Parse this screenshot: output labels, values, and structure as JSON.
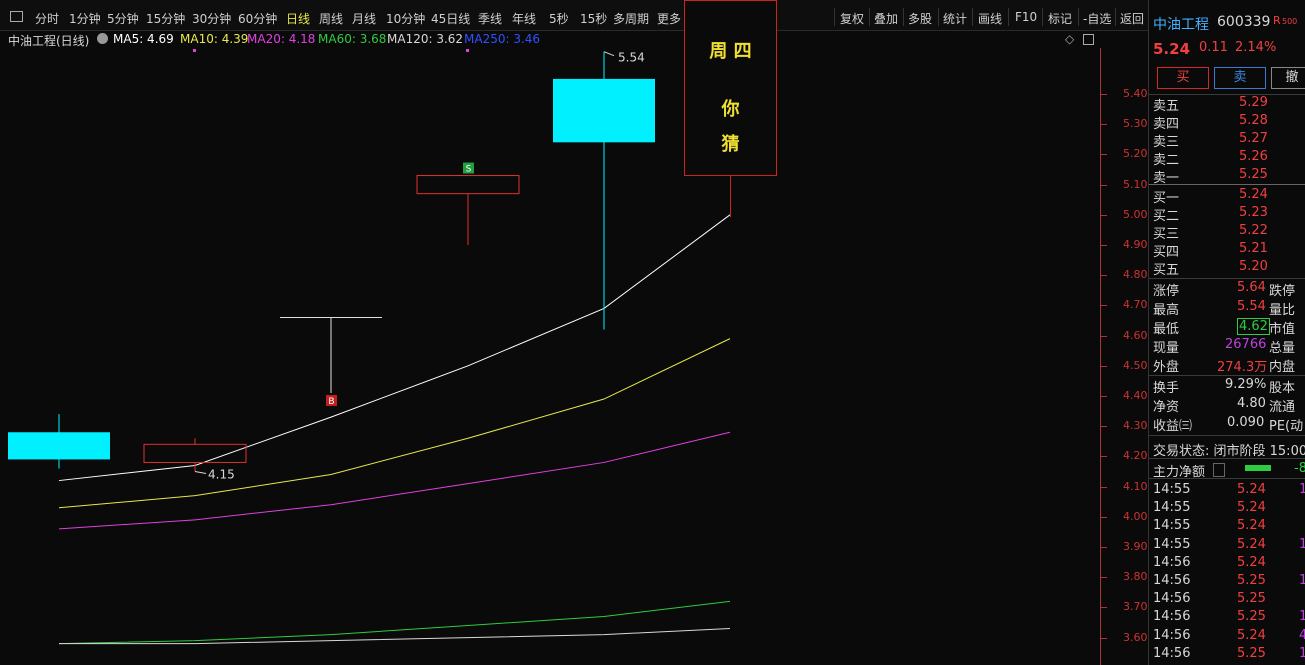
{
  "toolbar": {
    "periods": [
      "分时",
      "1分钟",
      "5分钟",
      "15分钟",
      "30分钟",
      "60分钟",
      "日线",
      "周线",
      "月线",
      "10分钟",
      "45日线",
      "季线",
      "年线",
      "5秒",
      "15秒",
      "多周期",
      "更多"
    ],
    "active_period": "日线",
    "tools": [
      "复权",
      "叠加",
      "多股",
      "统计",
      "画线",
      "F10",
      "标记",
      "-自选",
      "返回"
    ]
  },
  "ma_bar": {
    "title": "中油工程(日线)",
    "ma5": "MA5: 4.69",
    "ma10": "MA10: 4.39",
    "ma20": "MA20: 4.18",
    "ma60": "MA60: 3.68",
    "ma120": "MA120: 3.62",
    "ma250": "MA250: 3.46",
    "colors": {
      "ma5": "#ffffff",
      "ma10": "#e8e84a",
      "ma20": "#e040e0",
      "ma60": "#2ecc40",
      "ma120": "#d8d8d8",
      "ma250": "#3050ff"
    }
  },
  "annotations": {
    "high_label": "5.54",
    "low_label": "4.15",
    "buy_marker": "B",
    "sell_marker": "S",
    "callout_line1": "周 四",
    "callout_line2": "你",
    "callout_line3": "猜"
  },
  "price_axis": [
    "5.40",
    "5.30",
    "5.20",
    "5.10",
    "5.00",
    "4.90",
    "4.80",
    "4.70",
    "4.60",
    "4.50",
    "4.40",
    "4.30",
    "4.20",
    "4.10",
    "4.00",
    "3.90",
    "3.80",
    "3.70",
    "3.60"
  ],
  "chart_data": {
    "type": "candlestick",
    "y_range": [
      3.57,
      5.55
    ],
    "candles": [
      {
        "open": 4.28,
        "close": 4.19,
        "high": 4.34,
        "low": 4.16,
        "color": "cyan"
      },
      {
        "open": 4.18,
        "close": 4.24,
        "high": 4.26,
        "low": 4.15,
        "color": "red-hollow"
      },
      {
        "open": 4.66,
        "close": 4.66,
        "high": 4.66,
        "low": 4.41,
        "color": "white-doji"
      },
      {
        "open": 5.07,
        "close": 5.13,
        "high": 5.13,
        "low": 4.9,
        "color": "red-hollow"
      },
      {
        "open": 5.45,
        "close": 5.24,
        "high": 5.54,
        "low": 4.62,
        "color": "cyan"
      }
    ],
    "series": [
      {
        "name": "MA5",
        "color": "#ffffff",
        "values": [
          4.12,
          4.17,
          4.33,
          4.5,
          4.69,
          5.0
        ]
      },
      {
        "name": "MA10",
        "color": "#e8e84a",
        "values": [
          4.03,
          4.07,
          4.14,
          4.26,
          4.39,
          4.59
        ]
      },
      {
        "name": "MA20",
        "color": "#e040e0",
        "values": [
          3.96,
          3.99,
          4.04,
          4.11,
          4.18,
          4.28
        ]
      },
      {
        "name": "MA60",
        "color": "#2ecc40",
        "values": [
          3.58,
          3.59,
          3.61,
          3.64,
          3.67,
          3.72
        ]
      },
      {
        "name": "MA120",
        "color": "#d8d8d8",
        "values": [
          3.58,
          3.58,
          3.59,
          3.6,
          3.61,
          3.63
        ]
      }
    ]
  },
  "stock": {
    "name": "中油工程",
    "code": "600339",
    "badge": "R",
    "badge_num": "500",
    "price": "5.24",
    "change": "0.11",
    "pct": "2.14%"
  },
  "trade_buttons": {
    "buy": "买",
    "sell": "卖",
    "cancel": "撤"
  },
  "order_book": {
    "asks": [
      {
        "label": "卖五",
        "price": "5.29"
      },
      {
        "label": "卖四",
        "price": "5.28"
      },
      {
        "label": "卖三",
        "price": "5.27"
      },
      {
        "label": "卖二",
        "price": "5.26"
      },
      {
        "label": "卖一",
        "price": "5.25"
      }
    ],
    "bids": [
      {
        "label": "买一",
        "price": "5.24"
      },
      {
        "label": "买二",
        "price": "5.23"
      },
      {
        "label": "买三",
        "price": "5.22"
      },
      {
        "label": "买四",
        "price": "5.21"
      },
      {
        "label": "买五",
        "price": "5.20"
      }
    ]
  },
  "stats": [
    {
      "l1": "涨停",
      "v1": "5.64",
      "l2": "跌停"
    },
    {
      "l1": "最高",
      "v1": "5.54",
      "l2": "量比"
    },
    {
      "l1": "最低",
      "v1": "4.62",
      "l2": "市值"
    },
    {
      "l1": "现量",
      "v1": "26766",
      "l2": "总量"
    },
    {
      "l1": "外盘",
      "v1": "274.3万",
      "l2": "内盘"
    }
  ],
  "stats2": [
    {
      "l1": "换手",
      "v1": "9.29%",
      "l2": "股本"
    },
    {
      "l1": "净资",
      "v1": "4.80",
      "l2": "流通"
    },
    {
      "l1": "收益㈢",
      "v1": "0.090",
      "l2": "PE(动"
    }
  ],
  "trade_status": "交易状态: 闭市阶段 15:00",
  "main_flow": {
    "label": "主力净额",
    "value": "-8"
  },
  "ticks": [
    {
      "time": "14:55",
      "price": "5.24",
      "vol": "1"
    },
    {
      "time": "14:55",
      "price": "5.24",
      "vol": ""
    },
    {
      "time": "14:55",
      "price": "5.24",
      "vol": ""
    },
    {
      "time": "14:55",
      "price": "5.24",
      "vol": "1"
    },
    {
      "time": "14:56",
      "price": "5.24",
      "vol": ""
    },
    {
      "time": "14:56",
      "price": "5.25",
      "vol": "1"
    },
    {
      "time": "14:56",
      "price": "5.25",
      "vol": ""
    },
    {
      "time": "14:56",
      "price": "5.25",
      "vol": "1"
    },
    {
      "time": "14:56",
      "price": "5.24",
      "vol": "4"
    },
    {
      "time": "14:56",
      "price": "5.25",
      "vol": "1"
    }
  ]
}
